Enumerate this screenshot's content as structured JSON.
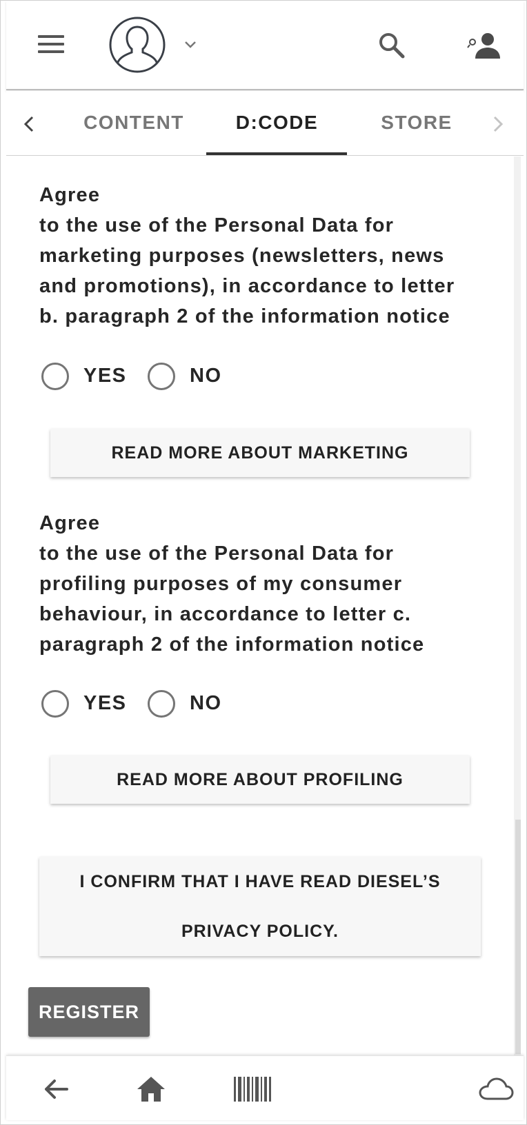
{
  "header": {
    "menu_icon": "hamburger-menu-icon",
    "avatar_icon": "user-avatar-icon",
    "search_icon": "search-icon",
    "account_icon": "manage-account-icon"
  },
  "tabs": {
    "items": [
      {
        "label": "CONTENT"
      },
      {
        "label": "D:CODE"
      },
      {
        "label": "STORE"
      }
    ],
    "active": "D:CODE"
  },
  "consents": [
    {
      "text": "Agree to the use of the Personal Data for marketing purposes (newsletters, news and promotions), in accordance to letter b. paragraph 2 of the information notice",
      "heading": "Agree",
      "body_lines": [
        "to the use of the Personal Data for",
        "marketing purposes (newsletters, news",
        "and promotions), in accordance to letter",
        "b. paragraph 2 of the information notice"
      ],
      "yes_label": "YES",
      "no_label": "NO",
      "read_more_label": "READ MORE ABOUT MARKETING"
    },
    {
      "heading": "Agree",
      "body_lines": [
        "to the use of the Personal Data for",
        "profiling purposes of my consumer",
        "behaviour, in accordance to letter c.",
        "paragraph 2 of the information notice"
      ],
      "yes_label": "YES",
      "no_label": "NO",
      "read_more_label": "READ MORE ABOUT PROFILING"
    }
  ],
  "confirm": {
    "line1": "I CONFIRM THAT I HAVE READ DIESEL’S",
    "line2": "PRIVACY POLICY."
  },
  "register_label": "REGISTER",
  "bottom_nav": {
    "back_icon": "back-arrow-icon",
    "home_icon": "home-icon",
    "barcode_icon": "barcode-icon",
    "cloud_icon": "cloud-icon"
  }
}
